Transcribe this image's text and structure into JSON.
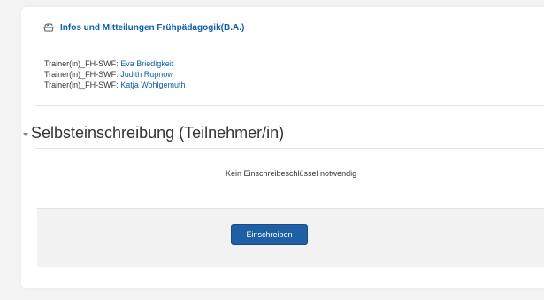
{
  "course": {
    "title": "Infos und Mitteilungen Frühpädagogik(B.A.)",
    "icon": "course-icon"
  },
  "teachers": [
    {
      "role": "Trainer(in)_FH-SWF:",
      "name": "Eva Briedigkeit"
    },
    {
      "role": "Trainer(in)_FH-SWF:",
      "name": "Judith Rupnow"
    },
    {
      "role": "Trainer(in)_FH-SWF:",
      "name": "Katja Wohlgemuth"
    }
  ],
  "section": {
    "title": "Selbsteinschreibung (Teilnehmer/in)",
    "icon": "collapse-icon"
  },
  "enrol": {
    "info_text": "Kein Einschreibeschlüssel notwendig",
    "button_label": "Einschreiben"
  },
  "colors": {
    "link": "#0f5fa8",
    "button": "#1f5fa3",
    "panel": "#f2f2f2"
  }
}
